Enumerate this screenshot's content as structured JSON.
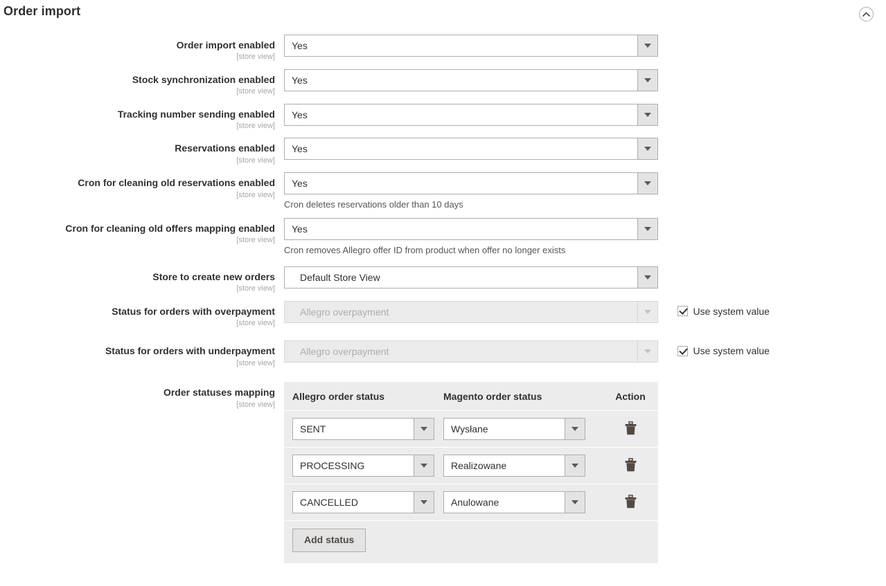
{
  "section": {
    "title": "Order import",
    "collapse_icon": "chevron-up-circle-icon"
  },
  "scope_label": "[store view]",
  "fields": [
    {
      "label": "Order import enabled",
      "scope": "[store view]",
      "value": "Yes",
      "note": "",
      "disabled": false,
      "system_value": null
    },
    {
      "label": "Stock synchronization enabled",
      "scope": "[store view]",
      "value": "Yes",
      "note": "",
      "disabled": false,
      "system_value": null
    },
    {
      "label": "Tracking number sending enabled",
      "scope": "[store view]",
      "value": "Yes",
      "note": "",
      "disabled": false,
      "system_value": null
    },
    {
      "label": "Reservations enabled",
      "scope": "[store view]",
      "value": "Yes",
      "note": "",
      "disabled": false,
      "system_value": null
    },
    {
      "label": "Cron for cleaning old reservations enabled",
      "scope": "[store view]",
      "value": "Yes",
      "note": "Cron deletes reservations older than 10 days",
      "disabled": false,
      "system_value": null
    },
    {
      "label": "Cron for cleaning old offers mapping enabled",
      "scope": "[store view]",
      "value": "Yes",
      "note": "Cron removes Allegro offer ID from product when offer no longer exists",
      "disabled": false,
      "system_value": null
    },
    {
      "label": "Store to create new orders",
      "scope": "[store view]",
      "value": "Default Store View",
      "note": "",
      "disabled": false,
      "indent": true,
      "system_value": null
    },
    {
      "label": "Status for orders with overpayment",
      "scope": "[store view]",
      "value": "Allegro overpayment",
      "note": "",
      "disabled": true,
      "system_value": "Use system value"
    },
    {
      "label": "Status for orders with underpayment",
      "scope": "[store view]",
      "value": "Allegro overpayment",
      "note": "",
      "disabled": true,
      "system_value": "Use system value"
    }
  ],
  "mapping": {
    "label": "Order statuses mapping",
    "scope": "[store view]",
    "columns": [
      "Allegro order status",
      "Magento order status",
      "Action"
    ],
    "rows": [
      {
        "allegro": "SENT",
        "magento": "Wysłane",
        "action_icon": "trash-icon"
      },
      {
        "allegro": "PROCESSING",
        "magento": "Realizowane",
        "action_icon": "trash-icon"
      },
      {
        "allegro": "CANCELLED",
        "magento": "Anulowane",
        "action_icon": "trash-icon"
      }
    ],
    "add_button": "Add status"
  }
}
